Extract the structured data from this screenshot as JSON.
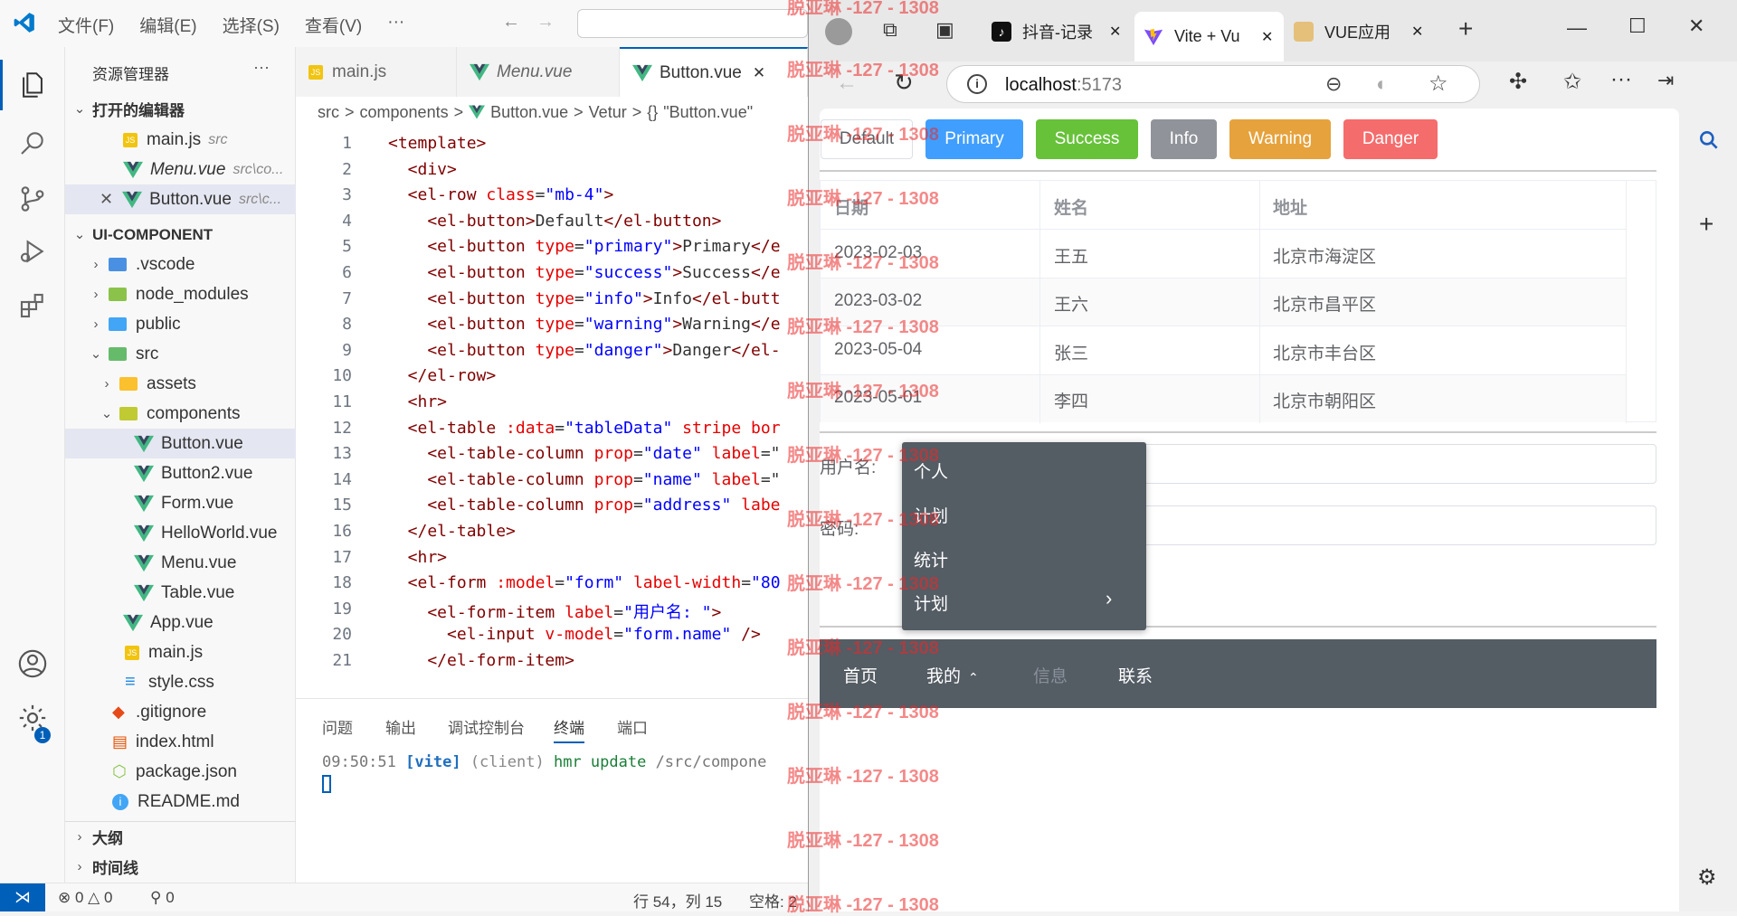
{
  "vscode": {
    "menu": [
      "文件(F)",
      "编辑(E)",
      "选择(S)",
      "查看(V)",
      "···"
    ],
    "sidebar": {
      "title": "资源管理器",
      "more": "···",
      "open_editors_label": "打开的编辑器",
      "open_editors": [
        {
          "name": "main.js",
          "hint": "src"
        },
        {
          "name": "Menu.vue",
          "hint": "src\\co..."
        },
        {
          "name": "Button.vue",
          "hint": "src\\c..."
        }
      ],
      "project_label": "UI-COMPONENT",
      "tree": [
        ".vscode",
        "node_modules",
        "public",
        "src",
        "assets",
        "components",
        "Button.vue",
        "Button2.vue",
        "Form.vue",
        "HelloWorld.vue",
        "Menu.vue",
        "Table.vue",
        "App.vue",
        "main.js",
        "style.css",
        ".gitignore",
        "index.html",
        "package.json",
        "README.md"
      ],
      "outline_label": "大纲",
      "timeline_label": "时间线"
    },
    "tabs": [
      {
        "label": "main.js"
      },
      {
        "label": "Menu.vue"
      },
      {
        "label": "Button.vue"
      }
    ],
    "breadcrumb": [
      "src",
      ">",
      "components",
      ">",
      "Button.vue",
      ">",
      "Vetur",
      ">",
      "{}",
      "\"Button.vue\""
    ],
    "line_numbers": [
      "1",
      "2",
      "3",
      "4",
      "5",
      "6",
      "7",
      "8",
      "9",
      "10",
      "11",
      "12",
      "13",
      "14",
      "15",
      "16",
      "17",
      "18",
      "19",
      "20",
      "21"
    ],
    "code": [
      [
        [
          "tg",
          "<template>"
        ]
      ],
      [
        [
          "tg",
          "  <div>"
        ]
      ],
      [
        [
          "tg",
          "  <el-row "
        ],
        [
          "at",
          "class"
        ],
        [
          "tx",
          "="
        ],
        [
          "st",
          "\"mb-4\""
        ],
        [
          "tg",
          ">"
        ]
      ],
      [
        [
          "tg",
          "    <el-button>"
        ],
        [
          "tx",
          "Default"
        ],
        [
          "tg",
          "</el-button>"
        ]
      ],
      [
        [
          "tg",
          "    <el-button "
        ],
        [
          "at",
          "type"
        ],
        [
          "tx",
          "="
        ],
        [
          "st",
          "\"primary\""
        ],
        [
          "tg",
          ">"
        ],
        [
          "tx",
          "Primary"
        ],
        [
          "tg",
          "</e"
        ]
      ],
      [
        [
          "tg",
          "    <el-button "
        ],
        [
          "at",
          "type"
        ],
        [
          "tx",
          "="
        ],
        [
          "st",
          "\"success\""
        ],
        [
          "tg",
          ">"
        ],
        [
          "tx",
          "Success"
        ],
        [
          "tg",
          "</e"
        ]
      ],
      [
        [
          "tg",
          "    <el-button "
        ],
        [
          "at",
          "type"
        ],
        [
          "tx",
          "="
        ],
        [
          "st",
          "\"info\""
        ],
        [
          "tg",
          ">"
        ],
        [
          "tx",
          "Info"
        ],
        [
          "tg",
          "</el-butt"
        ]
      ],
      [
        [
          "tg",
          "    <el-button "
        ],
        [
          "at",
          "type"
        ],
        [
          "tx",
          "="
        ],
        [
          "st",
          "\"warning\""
        ],
        [
          "tg",
          ">"
        ],
        [
          "tx",
          "Warning"
        ],
        [
          "tg",
          "</e"
        ]
      ],
      [
        [
          "tg",
          "    <el-button "
        ],
        [
          "at",
          "type"
        ],
        [
          "tx",
          "="
        ],
        [
          "st",
          "\"danger\""
        ],
        [
          "tg",
          ">"
        ],
        [
          "tx",
          "Danger"
        ],
        [
          "tg",
          "</el-"
        ]
      ],
      [
        [
          "tg",
          "  </el-row>"
        ]
      ],
      [
        [
          "tg",
          "  <hr>"
        ]
      ],
      [
        [
          "tg",
          "  <el-table "
        ],
        [
          "at",
          ":data"
        ],
        [
          "tx",
          "="
        ],
        [
          "st",
          "\"tableData\""
        ],
        [
          "tx",
          " "
        ],
        [
          "at",
          "stripe"
        ],
        [
          "tx",
          " "
        ],
        [
          "at",
          "bor"
        ]
      ],
      [
        [
          "tg",
          "    <el-table-column "
        ],
        [
          "at",
          "prop"
        ],
        [
          "tx",
          "="
        ],
        [
          "st",
          "\"date\""
        ],
        [
          "tx",
          " "
        ],
        [
          "at",
          "label"
        ],
        [
          "tx",
          "=\""
        ]
      ],
      [
        [
          "tg",
          "    <el-table-column "
        ],
        [
          "at",
          "prop"
        ],
        [
          "tx",
          "="
        ],
        [
          "st",
          "\"name\""
        ],
        [
          "tx",
          " "
        ],
        [
          "at",
          "label"
        ],
        [
          "tx",
          "=\""
        ]
      ],
      [
        [
          "tg",
          "    <el-table-column "
        ],
        [
          "at",
          "prop"
        ],
        [
          "tx",
          "="
        ],
        [
          "st",
          "\"address\""
        ],
        [
          "tx",
          " "
        ],
        [
          "at",
          "labe"
        ]
      ],
      [
        [
          "tg",
          "  </el-table>"
        ]
      ],
      [
        [
          "tg",
          "  <hr>"
        ]
      ],
      [
        [
          "tg",
          "  <el-form "
        ],
        [
          "at",
          ":model"
        ],
        [
          "tx",
          "="
        ],
        [
          "st",
          "\"form\""
        ],
        [
          "tx",
          " "
        ],
        [
          "at",
          "label-width"
        ],
        [
          "tx",
          "="
        ],
        [
          "st",
          "\"80"
        ]
      ],
      [
        [
          "tg",
          "    <el-form-item "
        ],
        [
          "at",
          "label"
        ],
        [
          "tx",
          "="
        ],
        [
          "st",
          "\"用户名: \""
        ],
        [
          "tg",
          ">"
        ]
      ],
      [
        [
          "tg",
          "      <el-input "
        ],
        [
          "at",
          "v-model"
        ],
        [
          "tx",
          "="
        ],
        [
          "st",
          "\"form.name\""
        ],
        [
          "tx",
          " "
        ],
        [
          "tg",
          "/>"
        ]
      ],
      [
        [
          "tg",
          "    </el-form-item>"
        ]
      ]
    ],
    "panel_tabs": [
      "问题",
      "输出",
      "调试控制台",
      "终端",
      "端口"
    ],
    "terminal": {
      "time": "09:50:51",
      "tag": "[vite]",
      "client": "(client)",
      "msg": "hmr update",
      "path": "/src/compone"
    },
    "status": {
      "errors": "0",
      "warnings": "0",
      "ports": "0",
      "position": "行 54，列 15",
      "spaces": "空格: 2"
    },
    "settings_badge": "1"
  },
  "browser": {
    "tabs": [
      {
        "label": "抖音-记录"
      },
      {
        "label": "Vite + Vu"
      },
      {
        "label": "VUE应用"
      }
    ],
    "url_host": "localhost",
    "url_port": ":5173",
    "buttons": [
      {
        "label": "Default",
        "color": "#ffffff"
      },
      {
        "label": "Primary",
        "color": "#409eff"
      },
      {
        "label": "Success",
        "color": "#67c23a"
      },
      {
        "label": "Info",
        "color": "#909399"
      },
      {
        "label": "Warning",
        "color": "#e6a23c"
      },
      {
        "label": "Danger",
        "color": "#f56c6c"
      }
    ],
    "table": {
      "headers": [
        "日期",
        "姓名",
        "地址"
      ],
      "rows": [
        [
          "2023-02-03",
          "王五",
          "北京市海淀区"
        ],
        [
          "2023-03-02",
          "王六",
          "北京市昌平区"
        ],
        [
          "2023-05-04",
          "张三",
          "北京市丰台区"
        ],
        [
          "2023-05-01",
          "李四",
          "北京市朝阳区"
        ]
      ]
    },
    "form": {
      "username_label": "用户名:",
      "password_label": "密码:"
    },
    "context_menu": [
      "个人",
      "计划",
      "统计",
      "计划"
    ],
    "context_submenu_arrow": "›",
    "navbar": [
      "首页",
      "我的",
      "信息",
      "联系"
    ],
    "navbar_colors": {
      "bg": "#545c64",
      "active": "#ffffff",
      "disabled": "#8a9099"
    }
  },
  "watermark": "脱亚琳 -127 - 1308"
}
